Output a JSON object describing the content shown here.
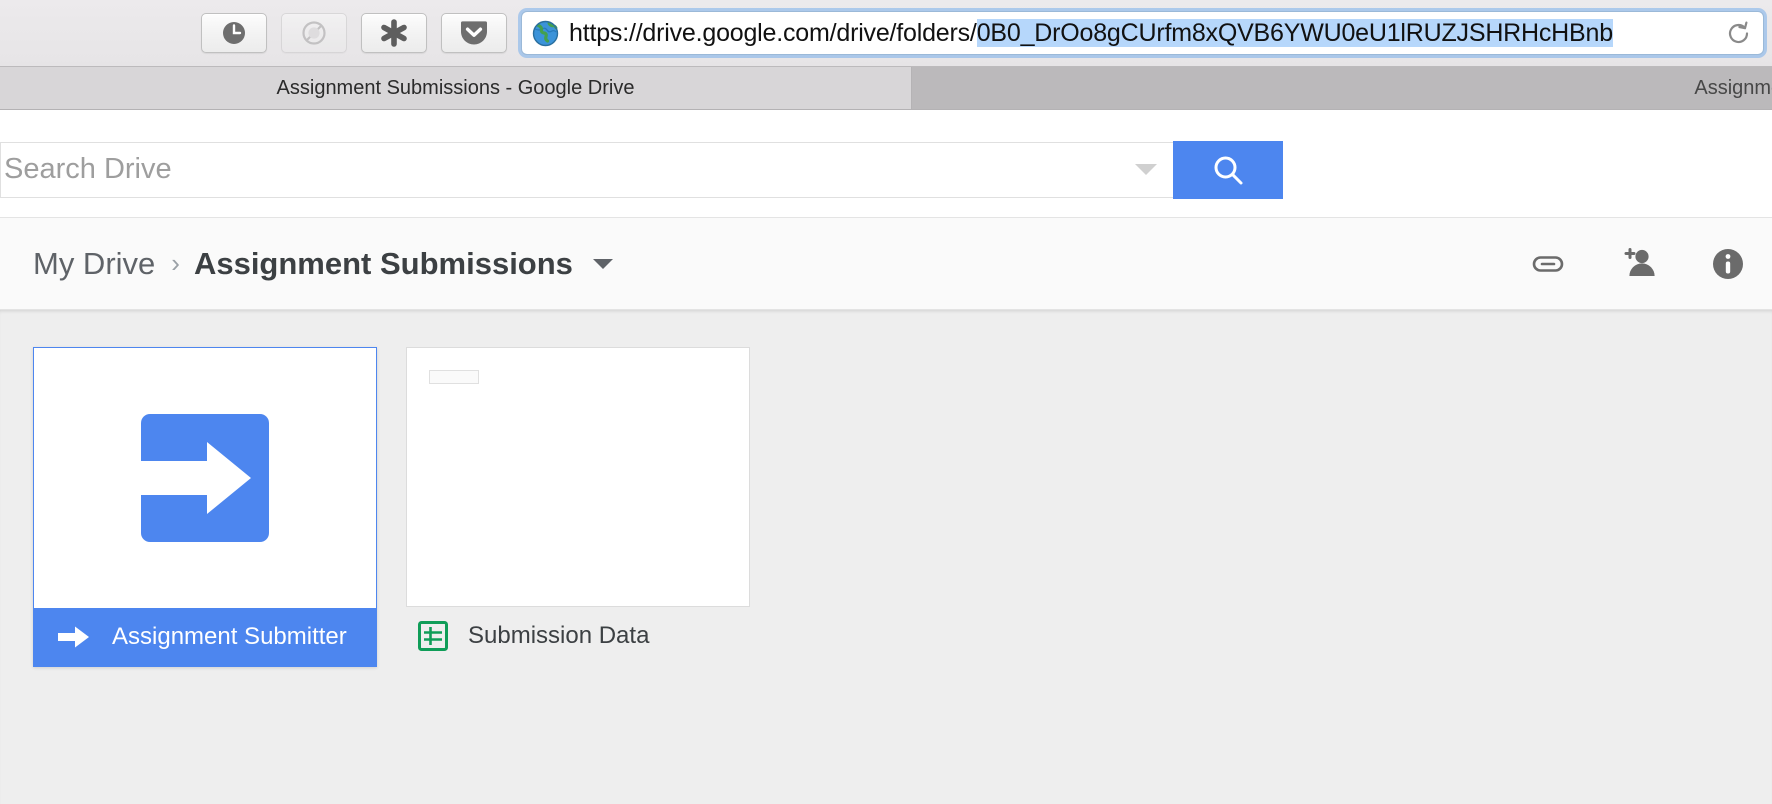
{
  "browser": {
    "extension_buttons": [
      {
        "name": "clock-icon",
        "label": "History",
        "disabled": false
      },
      {
        "name": "blocked-icon",
        "label": "Blocked",
        "disabled": true
      },
      {
        "name": "asterisk-icon",
        "label": "Extension",
        "disabled": false
      },
      {
        "name": "pocket-icon",
        "label": "Save to Pocket",
        "disabled": false
      }
    ],
    "url": {
      "prefix": "https://drive.google.com/drive/folders/",
      "selected": "0B0_DrOo8gCUrfm8xQVB6YWU0eU1lRUZJSHRHcHBnb",
      "full": "https://drive.google.com/drive/folders/0B0_DrOo8gCUrfm8xQVB6YWU0eU1lRUZJSHRHcHBnb",
      "site_icon": "globe-icon",
      "reload_icon": "reload-icon"
    },
    "tabs": [
      {
        "label": "Assignment Submissions - Google Drive",
        "active": true
      },
      {
        "label": "Assignment Sub",
        "active": false
      }
    ]
  },
  "search": {
    "placeholder": "Search Drive",
    "value": "",
    "dropdown_icon": "chevron-down-icon",
    "button_icon": "search-icon",
    "button_color": "#4d86ef"
  },
  "header": {
    "breadcrumb": {
      "root": "My Drive",
      "separator": "›",
      "current": "Assignment Submissions"
    },
    "actions": [
      {
        "name": "link-icon",
        "label": "Get shareable link"
      },
      {
        "name": "add-person-icon",
        "label": "Share"
      },
      {
        "name": "info-icon",
        "label": "Details"
      }
    ]
  },
  "files": [
    {
      "name": "Assignment Submitter",
      "type": "apps-script",
      "icon": "arrow-right-icon",
      "selected": true,
      "accent": "#4d86ef"
    },
    {
      "name": "Submission Data",
      "type": "spreadsheet",
      "icon": "sheets-icon",
      "selected": false,
      "accent": "#0f9d58"
    }
  ]
}
